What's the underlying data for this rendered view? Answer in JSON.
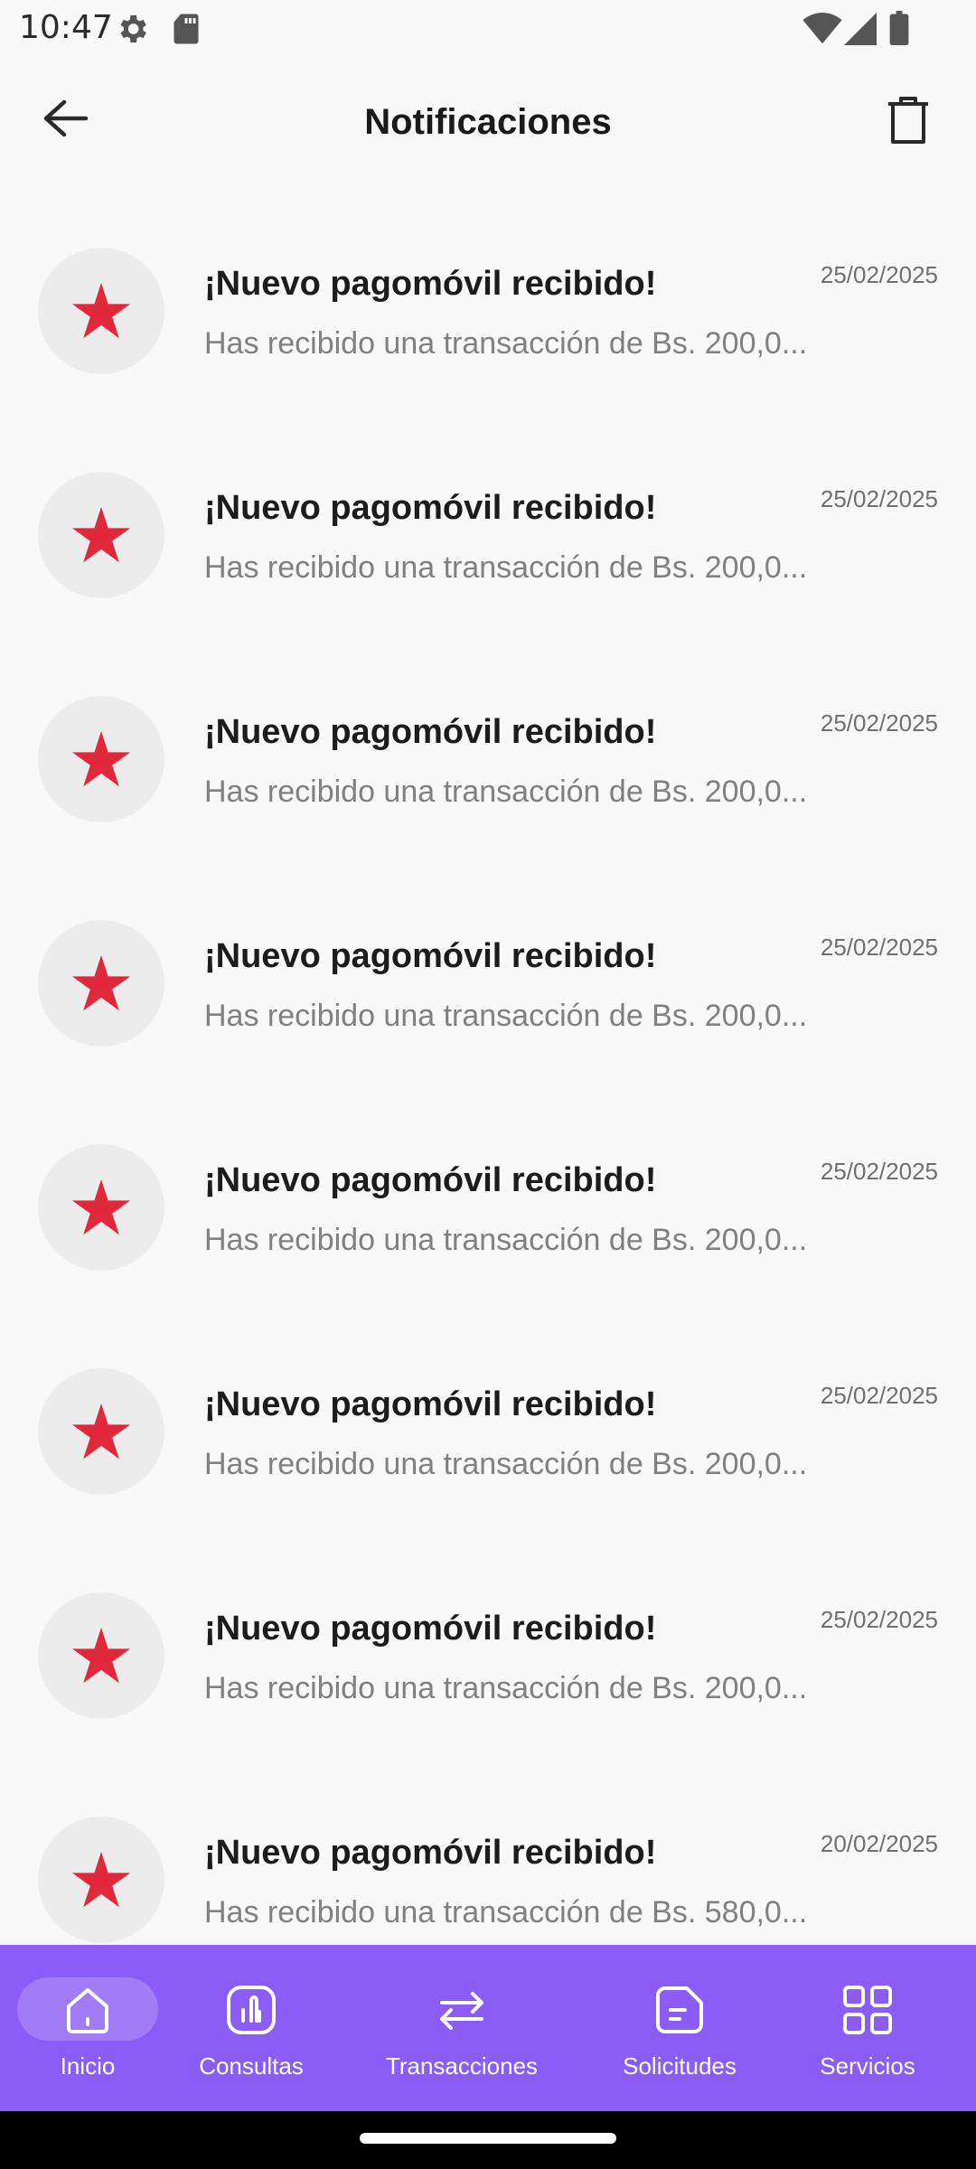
{
  "status_bar": {
    "time": "10:47",
    "icons": [
      "gear-icon",
      "sd-card-icon",
      "wifi-icon",
      "signal-icon",
      "battery-icon"
    ]
  },
  "header": {
    "title": "Notificaciones",
    "back_icon": "arrow-left-icon",
    "delete_icon": "trash-icon"
  },
  "colors": {
    "accent": "#8b5cf6",
    "star": "#e0283a",
    "avatar_bg": "#ececec",
    "background": "#f8f8f8"
  },
  "notifications": [
    {
      "title": "¡Nuevo pagomóvil recibido!",
      "date": "25/02/2025",
      "body": "Has recibido una transacción de Bs. 200,0...",
      "icon": "star-icon"
    },
    {
      "title": "¡Nuevo pagomóvil recibido!",
      "date": "25/02/2025",
      "body": "Has recibido una transacción de Bs. 200,0...",
      "icon": "star-icon"
    },
    {
      "title": "¡Nuevo pagomóvil recibido!",
      "date": "25/02/2025",
      "body": "Has recibido una transacción de Bs. 200,0...",
      "icon": "star-icon"
    },
    {
      "title": "¡Nuevo pagomóvil recibido!",
      "date": "25/02/2025",
      "body": "Has recibido una transacción de Bs. 200,0...",
      "icon": "star-icon"
    },
    {
      "title": "¡Nuevo pagomóvil recibido!",
      "date": "25/02/2025",
      "body": "Has recibido una transacción de Bs. 200,0...",
      "icon": "star-icon"
    },
    {
      "title": "¡Nuevo pagomóvil recibido!",
      "date": "25/02/2025",
      "body": "Has recibido una transacción de Bs. 200,0...",
      "icon": "star-icon"
    },
    {
      "title": "¡Nuevo pagomóvil recibido!",
      "date": "25/02/2025",
      "body": "Has recibido una transacción de Bs. 200,0...",
      "icon": "star-icon"
    },
    {
      "title": "¡Nuevo pagomóvil recibido!",
      "date": "20/02/2025",
      "body": "Has recibido una transacción de Bs. 580,0...",
      "icon": "star-icon"
    }
  ],
  "bottom_nav": {
    "active": "Inicio",
    "items": [
      {
        "label": "Inicio",
        "icon": "home-icon"
      },
      {
        "label": "Consultas",
        "icon": "chart-icon"
      },
      {
        "label": "Transacciones",
        "icon": "transfer-arrows-icon"
      },
      {
        "label": "Solicitudes",
        "icon": "document-icon"
      },
      {
        "label": "Servicios",
        "icon": "grid-icon"
      }
    ]
  }
}
